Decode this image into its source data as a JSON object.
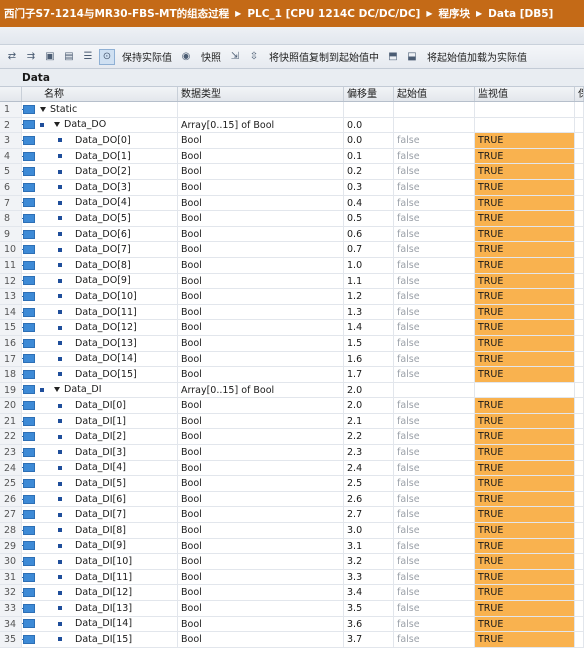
{
  "breadcrumb": [
    "西门子S7-1214与MR30-FBS-MT的组态过程",
    "PLC_1 [CPU 1214C DC/DC/DC]",
    "程序块",
    "Data [DB5]"
  ],
  "toolbar": {
    "snapshot_keep_label": "保持实际值",
    "snapshot_label": "快照",
    "copy_snapshot_label": "将快照值复制到起始值中",
    "load_start_label": "将起始值加载为实际值"
  },
  "block_title": "Data",
  "columns": {
    "name": "名称",
    "type": "数据类型",
    "offset": "偏移量",
    "start": "起始值",
    "monitor": "监视值",
    "extra": "保"
  },
  "rows": [
    {
      "num": "1",
      "level": 0,
      "name": "Static",
      "type": "",
      "offset": "",
      "start": "",
      "monitor": "",
      "kind": "struct"
    },
    {
      "num": "2",
      "level": 1,
      "name": "Data_DO",
      "type": "Array[0..15] of Bool",
      "offset": "0.0",
      "start": "",
      "monitor": "",
      "kind": "array"
    },
    {
      "num": "3",
      "level": 2,
      "name": "Data_DO[0]",
      "type": "Bool",
      "offset": "0.0",
      "start": "false",
      "monitor": "TRUE",
      "kind": "elem"
    },
    {
      "num": "4",
      "level": 2,
      "name": "Data_DO[1]",
      "type": "Bool",
      "offset": "0.1",
      "start": "false",
      "monitor": "TRUE",
      "kind": "elem"
    },
    {
      "num": "5",
      "level": 2,
      "name": "Data_DO[2]",
      "type": "Bool",
      "offset": "0.2",
      "start": "false",
      "monitor": "TRUE",
      "kind": "elem"
    },
    {
      "num": "6",
      "level": 2,
      "name": "Data_DO[3]",
      "type": "Bool",
      "offset": "0.3",
      "start": "false",
      "monitor": "TRUE",
      "kind": "elem"
    },
    {
      "num": "7",
      "level": 2,
      "name": "Data_DO[4]",
      "type": "Bool",
      "offset": "0.4",
      "start": "false",
      "monitor": "TRUE",
      "kind": "elem"
    },
    {
      "num": "8",
      "level": 2,
      "name": "Data_DO[5]",
      "type": "Bool",
      "offset": "0.5",
      "start": "false",
      "monitor": "TRUE",
      "kind": "elem"
    },
    {
      "num": "9",
      "level": 2,
      "name": "Data_DO[6]",
      "type": "Bool",
      "offset": "0.6",
      "start": "false",
      "monitor": "TRUE",
      "kind": "elem"
    },
    {
      "num": "10",
      "level": 2,
      "name": "Data_DO[7]",
      "type": "Bool",
      "offset": "0.7",
      "start": "false",
      "monitor": "TRUE",
      "kind": "elem"
    },
    {
      "num": "11",
      "level": 2,
      "name": "Data_DO[8]",
      "type": "Bool",
      "offset": "1.0",
      "start": "false",
      "monitor": "TRUE",
      "kind": "elem"
    },
    {
      "num": "12",
      "level": 2,
      "name": "Data_DO[9]",
      "type": "Bool",
      "offset": "1.1",
      "start": "false",
      "monitor": "TRUE",
      "kind": "elem"
    },
    {
      "num": "13",
      "level": 2,
      "name": "Data_DO[10]",
      "type": "Bool",
      "offset": "1.2",
      "start": "false",
      "monitor": "TRUE",
      "kind": "elem"
    },
    {
      "num": "14",
      "level": 2,
      "name": "Data_DO[11]",
      "type": "Bool",
      "offset": "1.3",
      "start": "false",
      "monitor": "TRUE",
      "kind": "elem"
    },
    {
      "num": "15",
      "level": 2,
      "name": "Data_DO[12]",
      "type": "Bool",
      "offset": "1.4",
      "start": "false",
      "monitor": "TRUE",
      "kind": "elem"
    },
    {
      "num": "16",
      "level": 2,
      "name": "Data_DO[13]",
      "type": "Bool",
      "offset": "1.5",
      "start": "false",
      "monitor": "TRUE",
      "kind": "elem"
    },
    {
      "num": "17",
      "level": 2,
      "name": "Data_DO[14]",
      "type": "Bool",
      "offset": "1.6",
      "start": "false",
      "monitor": "TRUE",
      "kind": "elem"
    },
    {
      "num": "18",
      "level": 2,
      "name": "Data_DO[15]",
      "type": "Bool",
      "offset": "1.7",
      "start": "false",
      "monitor": "TRUE",
      "kind": "elem"
    },
    {
      "num": "19",
      "level": 1,
      "name": "Data_DI",
      "type": "Array[0..15] of Bool",
      "offset": "2.0",
      "start": "",
      "monitor": "",
      "kind": "array"
    },
    {
      "num": "20",
      "level": 2,
      "name": "Data_DI[0]",
      "type": "Bool",
      "offset": "2.0",
      "start": "false",
      "monitor": "TRUE",
      "kind": "elem"
    },
    {
      "num": "21",
      "level": 2,
      "name": "Data_DI[1]",
      "type": "Bool",
      "offset": "2.1",
      "start": "false",
      "monitor": "TRUE",
      "kind": "elem"
    },
    {
      "num": "22",
      "level": 2,
      "name": "Data_DI[2]",
      "type": "Bool",
      "offset": "2.2",
      "start": "false",
      "monitor": "TRUE",
      "kind": "elem"
    },
    {
      "num": "23",
      "level": 2,
      "name": "Data_DI[3]",
      "type": "Bool",
      "offset": "2.3",
      "start": "false",
      "monitor": "TRUE",
      "kind": "elem"
    },
    {
      "num": "24",
      "level": 2,
      "name": "Data_DI[4]",
      "type": "Bool",
      "offset": "2.4",
      "start": "false",
      "monitor": "TRUE",
      "kind": "elem"
    },
    {
      "num": "25",
      "level": 2,
      "name": "Data_DI[5]",
      "type": "Bool",
      "offset": "2.5",
      "start": "false",
      "monitor": "TRUE",
      "kind": "elem"
    },
    {
      "num": "26",
      "level": 2,
      "name": "Data_DI[6]",
      "type": "Bool",
      "offset": "2.6",
      "start": "false",
      "monitor": "TRUE",
      "kind": "elem"
    },
    {
      "num": "27",
      "level": 2,
      "name": "Data_DI[7]",
      "type": "Bool",
      "offset": "2.7",
      "start": "false",
      "monitor": "TRUE",
      "kind": "elem"
    },
    {
      "num": "28",
      "level": 2,
      "name": "Data_DI[8]",
      "type": "Bool",
      "offset": "3.0",
      "start": "false",
      "monitor": "TRUE",
      "kind": "elem"
    },
    {
      "num": "29",
      "level": 2,
      "name": "Data_DI[9]",
      "type": "Bool",
      "offset": "3.1",
      "start": "false",
      "monitor": "TRUE",
      "kind": "elem"
    },
    {
      "num": "30",
      "level": 2,
      "name": "Data_DI[10]",
      "type": "Bool",
      "offset": "3.2",
      "start": "false",
      "monitor": "TRUE",
      "kind": "elem"
    },
    {
      "num": "31",
      "level": 2,
      "name": "Data_DI[11]",
      "type": "Bool",
      "offset": "3.3",
      "start": "false",
      "monitor": "TRUE",
      "kind": "elem"
    },
    {
      "num": "32",
      "level": 2,
      "name": "Data_DI[12]",
      "type": "Bool",
      "offset": "3.4",
      "start": "false",
      "monitor": "TRUE",
      "kind": "elem"
    },
    {
      "num": "33",
      "level": 2,
      "name": "Data_DI[13]",
      "type": "Bool",
      "offset": "3.5",
      "start": "false",
      "monitor": "TRUE",
      "kind": "elem"
    },
    {
      "num": "34",
      "level": 2,
      "name": "Data_DI[14]",
      "type": "Bool",
      "offset": "3.6",
      "start": "false",
      "monitor": "TRUE",
      "kind": "elem"
    },
    {
      "num": "35",
      "level": 2,
      "name": "Data_DI[15]",
      "type": "Bool",
      "offset": "3.7",
      "start": "false",
      "monitor": "TRUE",
      "kind": "elem"
    }
  ],
  "colors": {
    "titlebar": "#c46a17",
    "monitor_true": "#f9b24f",
    "db_icon": "#3d8ad6"
  }
}
